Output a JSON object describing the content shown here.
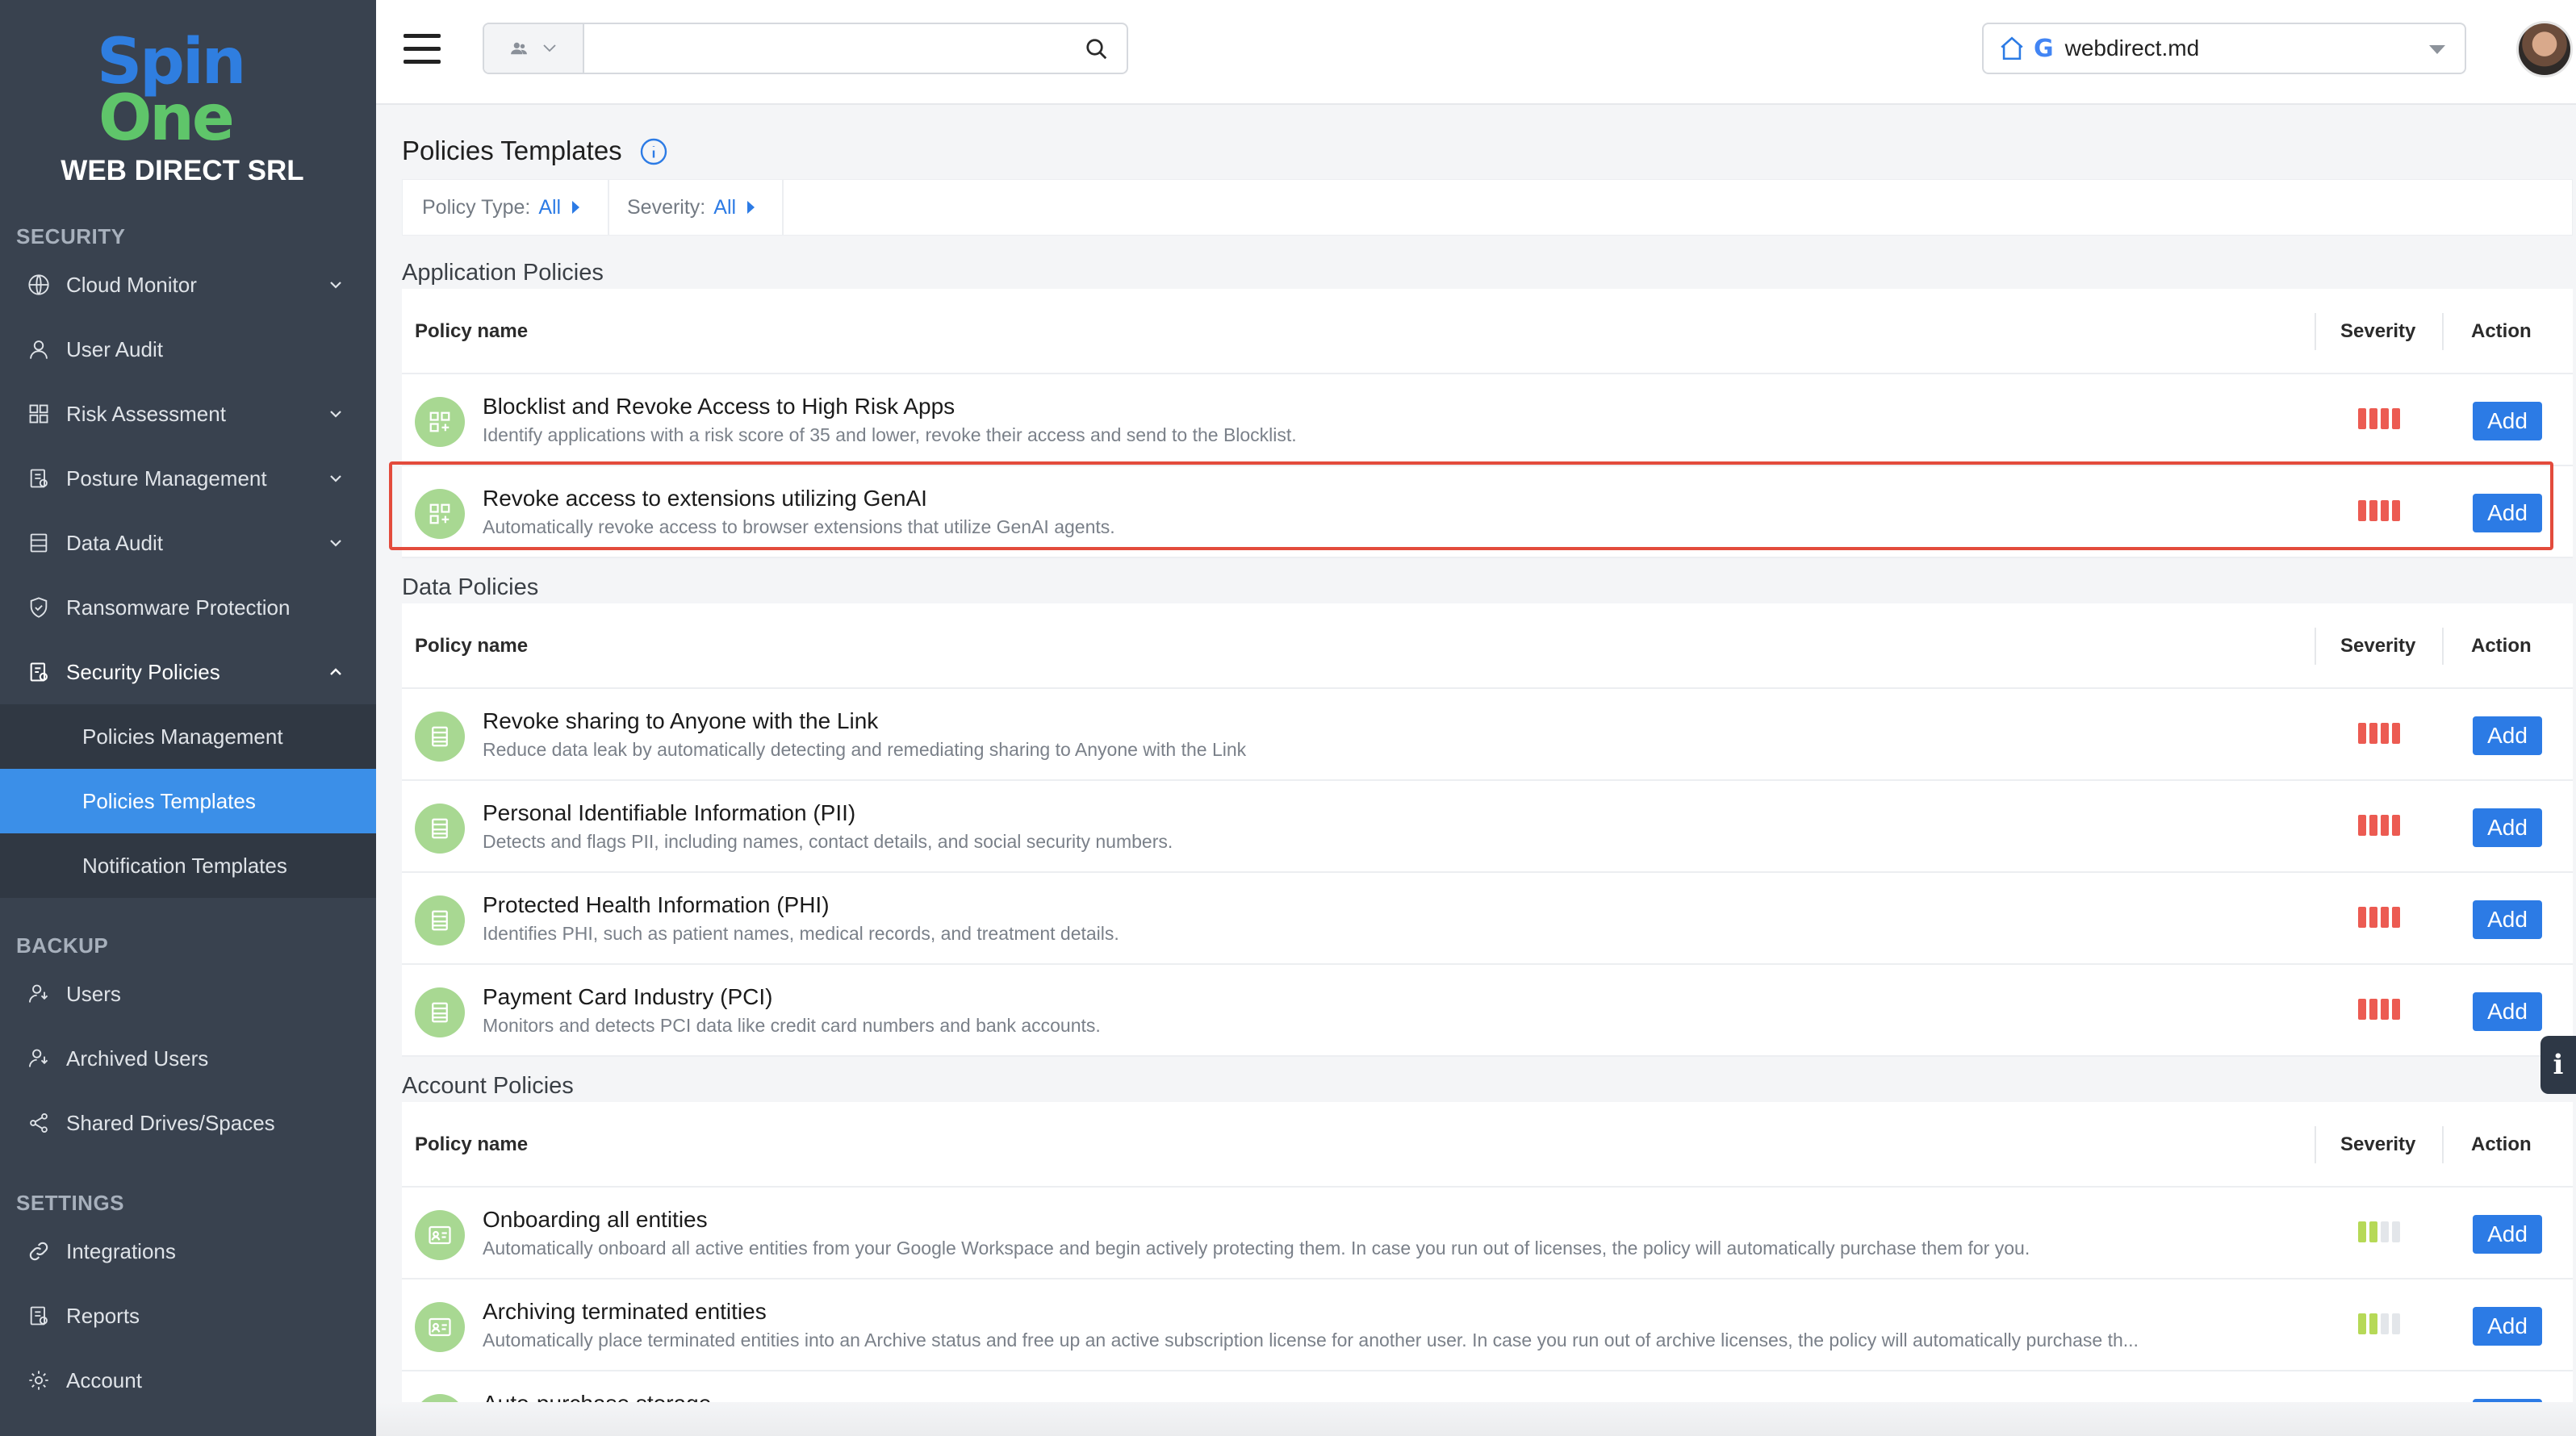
{
  "brand": {
    "logo_line1": "Spin",
    "logo_line2": "One",
    "company": "WEB DIRECT SRL"
  },
  "sidebar": {
    "security_title": "SECURITY",
    "backup_title": "BACKUP",
    "settings_title": "SETTINGS",
    "items": {
      "cloud_monitor": "Cloud Monitor",
      "user_audit": "User Audit",
      "risk_assessment": "Risk Assessment",
      "posture_management": "Posture Management",
      "data_audit": "Data Audit",
      "ransomware_protection": "Ransomware Protection",
      "security_policies": "Security Policies",
      "policies_management": "Policies Management",
      "policies_templates": "Policies Templates",
      "notification_templates": "Notification Templates",
      "users": "Users",
      "archived_users": "Archived Users",
      "shared_drives": "Shared Drives/Spaces",
      "integrations": "Integrations",
      "reports": "Reports",
      "account": "Account"
    }
  },
  "header": {
    "search_value": "",
    "search_placeholder": "",
    "domain": "webdirect.md"
  },
  "page": {
    "title": "Policies Templates",
    "filters": {
      "type_label": "Policy Type:",
      "type_value": "All",
      "severity_label": "Severity:",
      "severity_value": "All"
    },
    "columns": {
      "name": "Policy name",
      "severity": "Severity",
      "action": "Action"
    },
    "add_label": "Add",
    "severity_colors": {
      "high": "#ec5b52",
      "low_on": "#b6d957",
      "low_off": "#e3e6ea"
    },
    "groups": {
      "application": {
        "title": "Application Policies",
        "rows": [
          {
            "name": "Blocklist and Revoke Access to High Risk Apps",
            "desc": "Identify applications with a risk score of 35 and lower, revoke their access and send to the Blocklist.",
            "severity": "high",
            "icon": "apps-icon"
          },
          {
            "name": "Revoke access to extensions utilizing GenAI",
            "desc": "Automatically revoke access to browser extensions that utilize GenAI agents.",
            "severity": "high",
            "icon": "apps-icon"
          }
        ]
      },
      "data": {
        "title": "Data Policies",
        "rows": [
          {
            "name": "Revoke sharing to Anyone with the Link",
            "desc": "Reduce data leak by automatically detecting and remediating sharing to Anyone with the Link",
            "severity": "high",
            "icon": "document-icon"
          },
          {
            "name": "Personal Identifiable Information (PII)",
            "desc": "Detects and flags PII, including names, contact details, and social security numbers.",
            "severity": "high",
            "icon": "document-icon"
          },
          {
            "name": "Protected Health Information (PHI)",
            "desc": "Identifies PHI, such as patient names, medical records, and treatment details.",
            "severity": "high",
            "icon": "document-icon"
          },
          {
            "name": "Payment Card Industry (PCI)",
            "desc": "Monitors and detects PCI data like credit card numbers and bank accounts.",
            "severity": "high",
            "icon": "document-icon"
          }
        ]
      },
      "account": {
        "title": "Account Policies",
        "rows": [
          {
            "name": "Onboarding all entities",
            "desc": "Automatically onboard all active entities from your Google Workspace and begin actively protecting them. In case you run out of licenses, the policy will automatically purchase them for you.",
            "severity": "low",
            "icon": "id-card-icon"
          },
          {
            "name": "Archiving terminated entities",
            "desc": "Automatically place terminated entities into an Archive status and free up an active subscription license for another user. In case you run out of archive licenses, the policy will automatically purchase th...",
            "severity": "low",
            "icon": "id-card-icon"
          },
          {
            "name": "Auto-purchase storage",
            "desc": "",
            "severity": "low",
            "icon": "id-card-icon"
          }
        ]
      }
    }
  }
}
